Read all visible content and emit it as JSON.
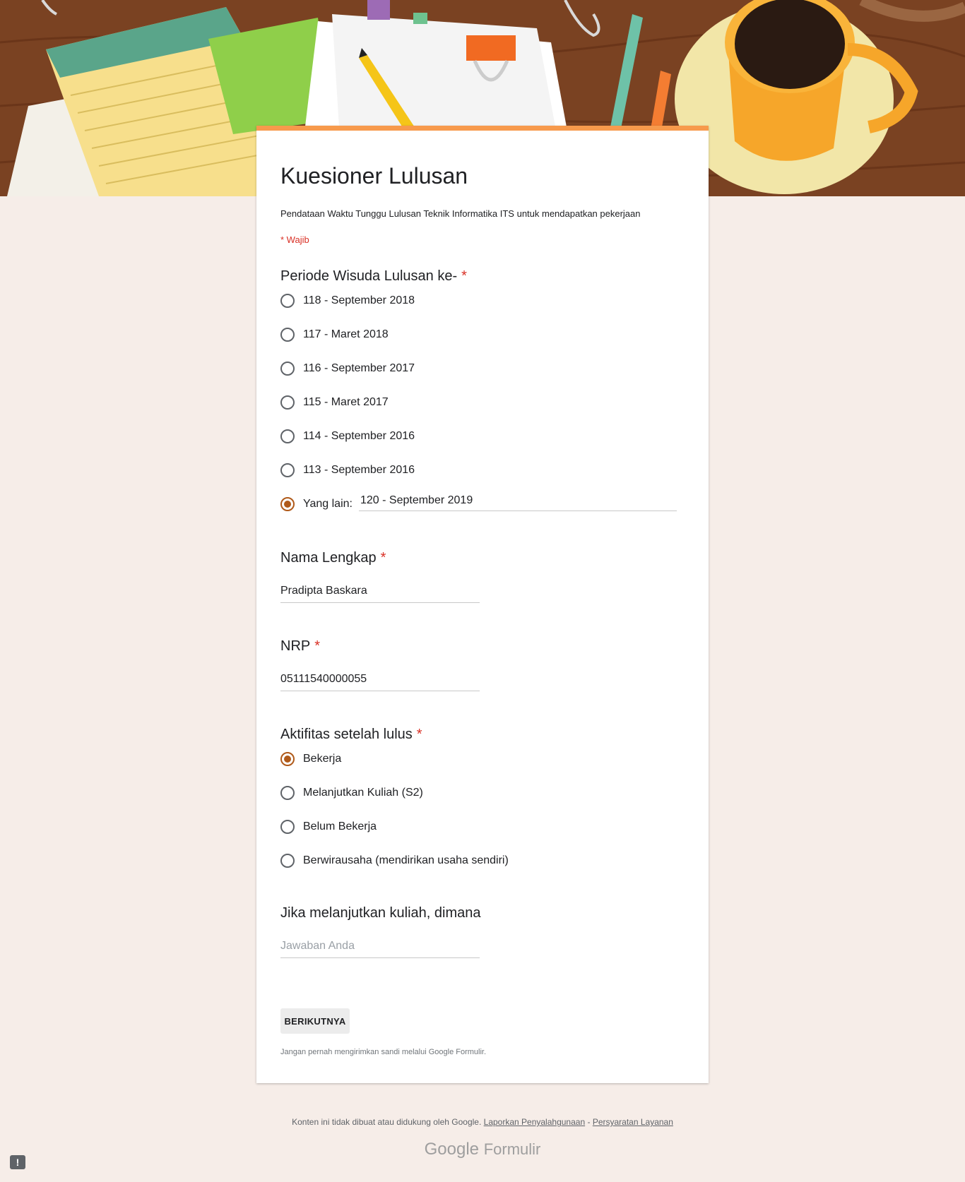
{
  "form": {
    "title": "Kuesioner Lulusan",
    "description": "Pendataan Waktu Tunggu Lulusan Teknik Informatika ITS untuk mendapatkan pekerjaan",
    "required_note": "* Wajib",
    "accent_color": "#f79a4c"
  },
  "questions": {
    "periode": {
      "title": "Periode Wisuda Lulusan ke-",
      "required": "*",
      "options": [
        "118 - September 2018",
        "117 - Maret 2018",
        "116 - September 2017",
        "115 - Maret 2017",
        "114 - September 2016",
        "113 - September 2016"
      ],
      "other_label": "Yang lain:",
      "other_value": "120 - September 2019",
      "selected": "other"
    },
    "nama": {
      "title": "Nama Lengkap",
      "required": "*",
      "value": "Pradipta Baskara"
    },
    "nrp": {
      "title": "NRP",
      "required": "*",
      "value": "05111540000055"
    },
    "aktifitas": {
      "title": "Aktifitas setelah lulus",
      "required": "*",
      "options": [
        "Bekerja",
        "Melanjutkan Kuliah (S2)",
        "Belum Bekerja",
        "Berwirausaha (mendirikan usaha sendiri)"
      ],
      "selected": "Bekerja"
    },
    "kuliah": {
      "title": "Jika melanjutkan kuliah, dimana",
      "placeholder": "Jawaban Anda"
    }
  },
  "buttons": {
    "next": "BERIKUTNYA"
  },
  "password_note": "Jangan pernah mengirimkan sandi melalui Google Formulir.",
  "footer": {
    "disclaimer": "Konten ini tidak dibuat atau didukung oleh Google.",
    "report_link": "Laporkan Penyalahgunaan",
    "separator": "-",
    "terms_link": "Persyaratan Layanan",
    "brand_google": "Google",
    "brand_formulir": "Formulir"
  },
  "icons": {
    "report": "report-issue-icon"
  }
}
